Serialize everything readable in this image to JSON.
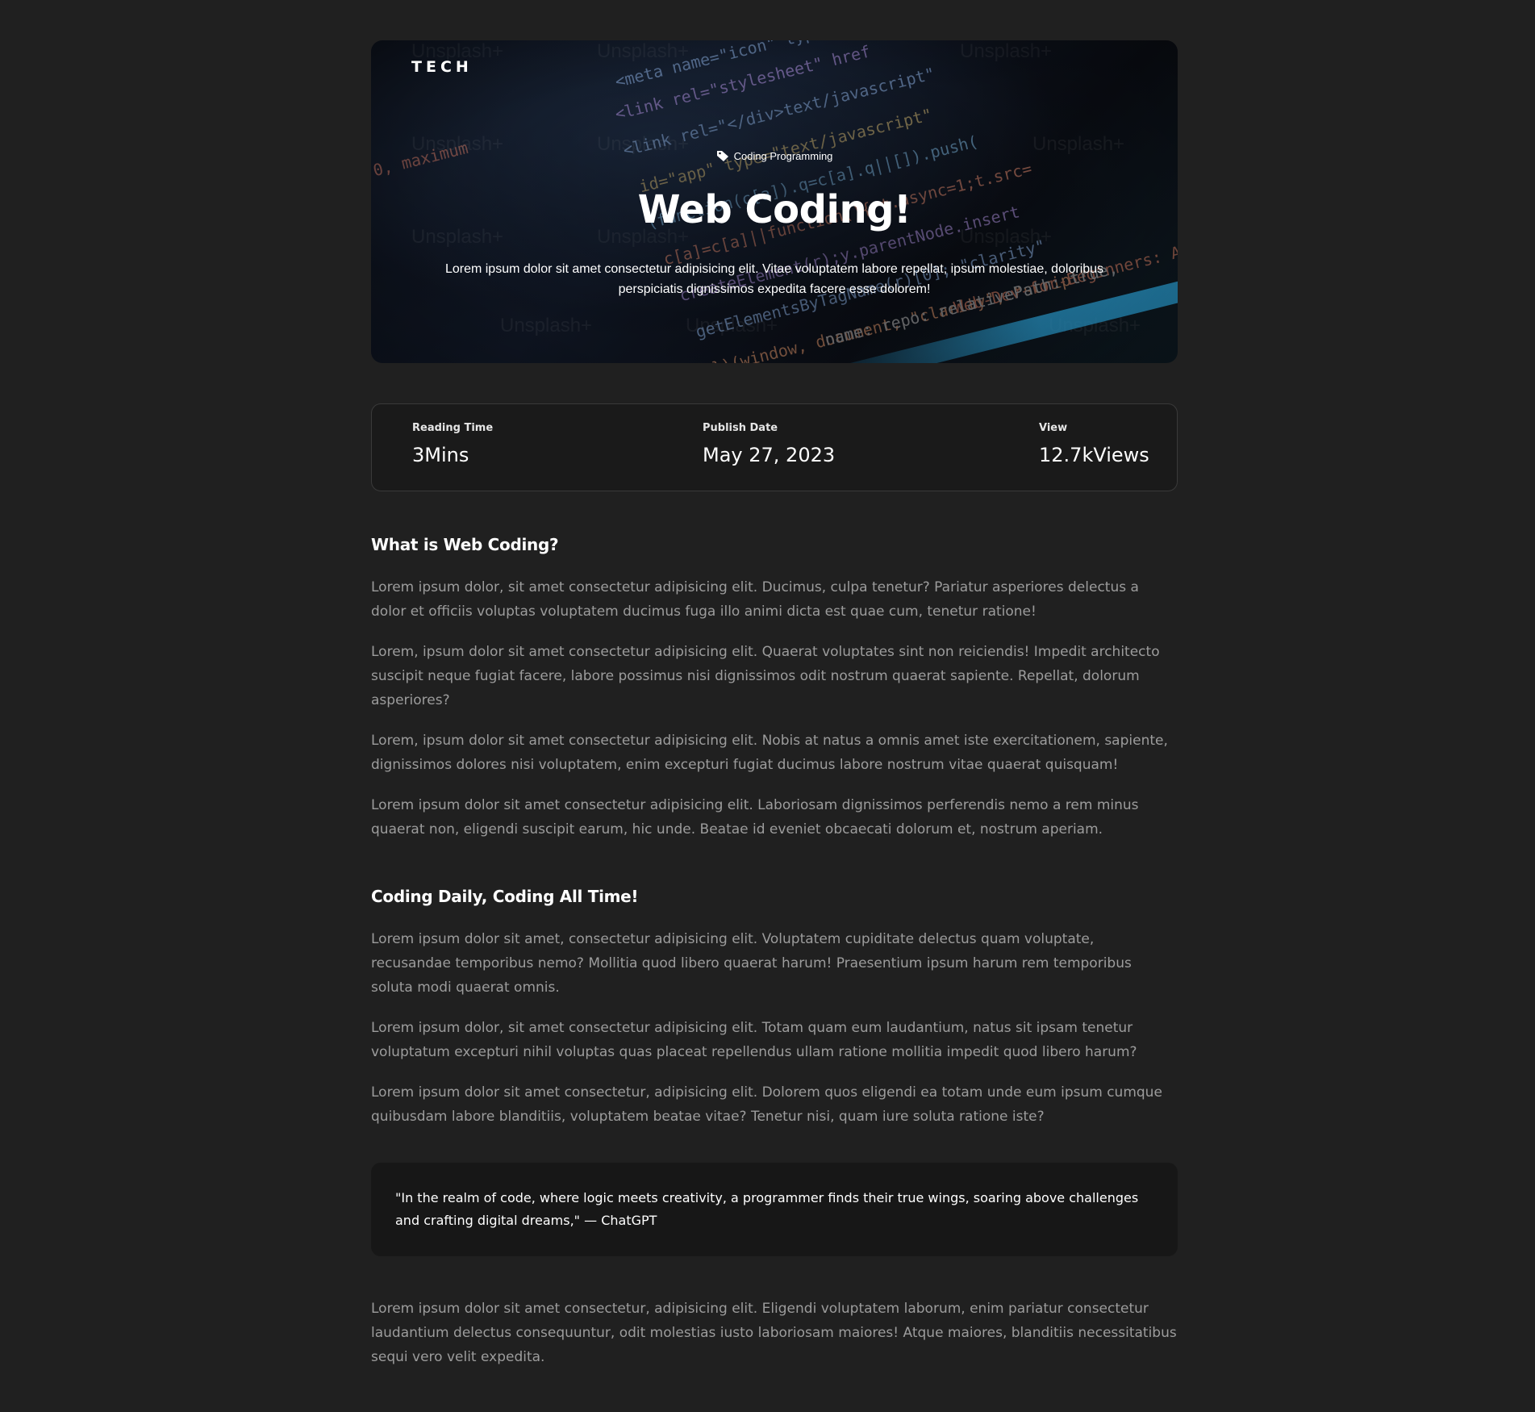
{
  "hero": {
    "brand": "TECH",
    "category": "Coding Programming",
    "category_icon": "tag-icon",
    "title": "Web Coding!",
    "description": "Lorem ipsum dolor sit amet consectetur adipisicing elit. Vitae voluptatem labore repellat, ipsum molestiae, doloribus perspiciatis dignissimos expedita facere esse dolorem!",
    "watermark": "Unsplash+"
  },
  "stats": {
    "reading_label": "Reading Time",
    "reading_value": "3Mins",
    "date_label": "Publish Date",
    "date_value": "May 27, 2023",
    "views_label": "View",
    "views_value": "12.7kViews"
  },
  "article": {
    "section1": {
      "heading": "What is Web Coding?",
      "paragraphs": [
        "Lorem ipsum dolor, sit amet consectetur adipisicing elit. Ducimus, culpa tenetur? Pariatur asperiores delectus a dolor et officiis voluptas voluptatem ducimus fuga illo animi dicta est quae cum, tenetur ratione!",
        "Lorem, ipsum dolor sit amet consectetur adipisicing elit. Quaerat voluptates sint non reiciendis! Impedit architecto suscipit neque fugiat facere, labore possimus nisi dignissimos odit nostrum quaerat sapiente. Repellat, dolorum asperiores?",
        "Lorem, ipsum dolor sit amet consectetur adipisicing elit. Nobis at natus a omnis amet iste exercitationem, sapiente, dignissimos dolores nisi voluptatem, enim excepturi fugiat ducimus labore nostrum vitae quaerat quisquam!",
        "Lorem ipsum dolor sit amet consectetur adipisicing elit. Laboriosam dignissimos perferendis nemo a rem minus quaerat non, eligendi suscipit earum, hic unde. Beatae id eveniet obcaecati dolorum et, nostrum aperiam."
      ]
    },
    "section2": {
      "heading": "Coding Daily, Coding All Time!",
      "paragraphs": [
        "Lorem ipsum dolor sit amet, consectetur adipisicing elit. Voluptatem cupiditate delectus quam voluptate, recusandae temporibus nemo? Mollitia quod libero quaerat harum! Praesentium ipsum harum rem temporibus soluta modi quaerat omnis.",
        "Lorem ipsum dolor, sit amet consectetur adipisicing elit. Totam quam eum laudantium, natus sit ipsam tenetur voluptatum excepturi nihil voluptas quas placeat repellendus ullam ratione mollitia impedit quod libero harum?",
        "Lorem ipsum dolor sit amet consectetur, adipisicing elit. Dolorem quos eligendi ea totam unde eum ipsum cumque quibusdam labore blanditiis, voluptatem beatae vitae? Tenetur nisi, quam iure soluta ratione iste?"
      ]
    },
    "quote": "\"In the realm of code, where logic meets creativity, a programmer finds their true wings, soaring above challenges and crafting digital dreams,\" — ChatGPT",
    "closing_paragraph": "Lorem ipsum dolor sit amet consectetur, adipisicing elit. Eligendi voluptatem laborum, enim pariatur consectetur laudantium delectus consequuntur, odit molestias iusto laboriosam maiores! Atque maiores, blanditiis necessitatibus sequi vero velit expedita."
  },
  "colors": {
    "background": "#202020",
    "card": "#1a1a1a",
    "quote_bg": "#171717",
    "body_text": "#9c9c9c",
    "heading_text": "#ffffff"
  }
}
